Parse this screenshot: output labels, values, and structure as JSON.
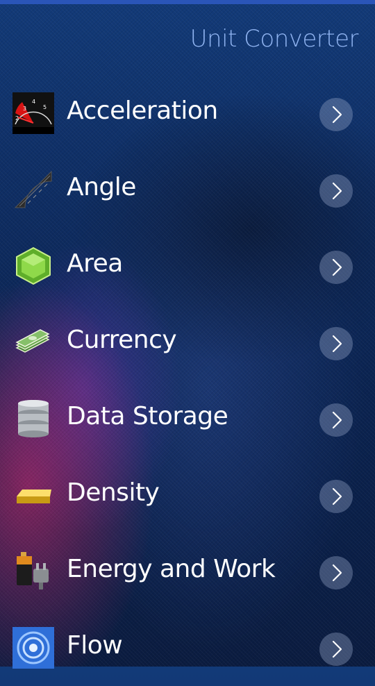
{
  "header": {
    "title": "Unit Converter"
  },
  "categories": [
    {
      "label": "Acceleration",
      "icon": "tachometer-icon"
    },
    {
      "label": "Angle",
      "icon": "protractor-icon"
    },
    {
      "label": "Area",
      "icon": "hexagon-icon"
    },
    {
      "label": "Currency",
      "icon": "banknotes-icon"
    },
    {
      "label": "Data Storage",
      "icon": "database-icon"
    },
    {
      "label": "Density",
      "icon": "gold-bar-icon"
    },
    {
      "label": "Energy and Work",
      "icon": "battery-plug-icon"
    },
    {
      "label": "Flow",
      "icon": "water-swirl-icon"
    }
  ],
  "colors": {
    "accent": "#8fb3f0",
    "topbar": "#2a55b8",
    "chevron_bg": "#8a97bd"
  }
}
